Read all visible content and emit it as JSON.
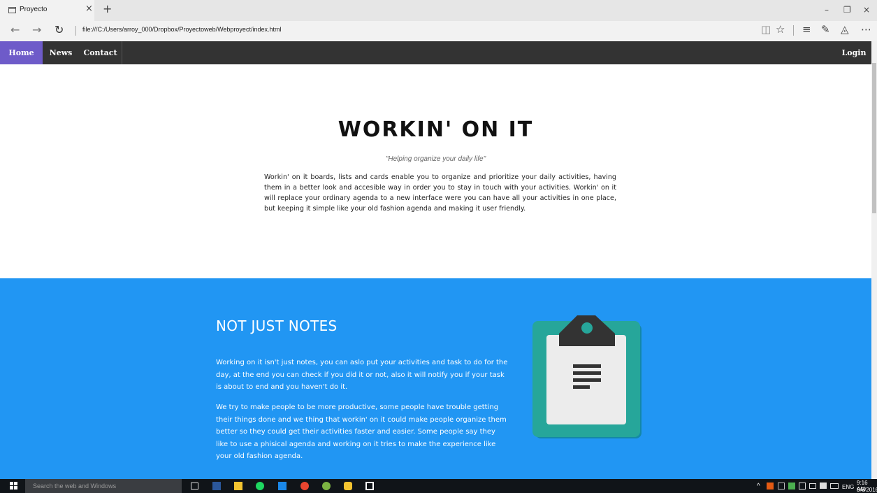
{
  "browser": {
    "tab_title": "Proyecto",
    "tab_close": "×",
    "new_tab": "+",
    "url": "file:///C:/Users/arroy_000/Dropbox/Proyectoweb/Webproyect/index.html",
    "back": "←",
    "forward": "→",
    "refresh": "↻",
    "minimize": "–",
    "restore": "❐",
    "close": "×",
    "reading_view": "◫",
    "favorite": "☆",
    "hub": "≡",
    "web_note": "✎",
    "share": "◬",
    "more": "⋯"
  },
  "nav": {
    "home": "Home",
    "news": "News",
    "contact": "Contact",
    "login": "Login",
    "active_color": "#6e5bc9"
  },
  "hero": {
    "title": "WORKIN' ON IT",
    "subtitle": "\"Helping organize your daily life\"",
    "body": "Workin' on it boards, lists and cards enable you to organize and prioritize your daily activities, having them in a better look and accesible way in order you to stay in touch with your activities. Workin' on it will replace your ordinary agenda to a new interface were you can have all your activities in one place, but keeping it simple like your old fashion agenda and making it user friendly."
  },
  "feature": {
    "heading": "NOT JUST NOTES",
    "paragraph1": "Working on it isn't just notes, you can aslo put your activities and task to do for the day, at the end you can check if you did it or not, also it will notify you if your task is about to end and you haven't do it.",
    "paragraph2": "We try to make people to be more productive, some people have trouble getting their things done and we thing that workin' on it could make people organize them better so they could get their activities faster and easier. Some people say they like to use a phisical agenda and working on it tries to make the experience like your old fashion agenda.",
    "background_color": "#2196f3",
    "illustration": "clipboard-icon"
  },
  "taskbar": {
    "search_placeholder": "Search the web and Windows",
    "language": "ENG",
    "time": "9:16 AM",
    "date": "9/6/2016",
    "tray_chevron": "^"
  }
}
